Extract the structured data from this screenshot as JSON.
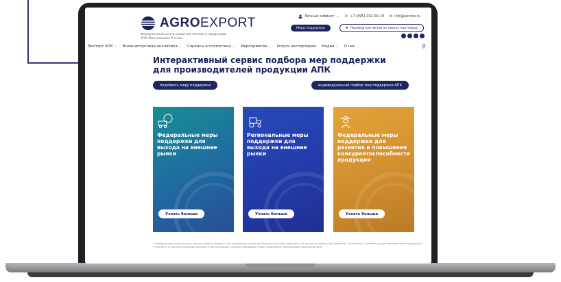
{
  "header": {
    "logo_bold": "AGRO",
    "logo_rest": "EXPORT",
    "logo_subtitle": "Федеральный центр развития экспорта продукции АПК Минсельхоза России",
    "cabinet_link": "Личный кабинет",
    "phone": "+7 (495) 232-00-19",
    "email": "info@aemcx.ru",
    "pill_dark": "Меры поддержки",
    "pill_outline": "Перевод контактов по поиску партнеров"
  },
  "nav": {
    "items": [
      "Экспорт АПК",
      "Внешнеторговая аналитика",
      "Сервисы и статистика",
      "Мероприятия",
      "Услуги экспортерам",
      "Медиа",
      "О нас"
    ]
  },
  "main": {
    "title": "Интерактивный сервис подбора мер поддержки для производителей продукции АПК",
    "btn_left": "подобрать меру поддержки",
    "btn_right": "индивидуальный подбор мер поддержки АПК",
    "cards": [
      {
        "text": "Федеральные меры поддержки для выхода на внешние рынки",
        "button": "Узнать больше"
      },
      {
        "text": "Региональные меры поддержки для выхода на внешние рынки",
        "button": "Узнать больше"
      },
      {
        "text": "Федеральные меры поддержки для развития и повышения конкурентоспособности продукции",
        "button": "Узнать больше"
      }
    ],
    "footnote": "* Информационный интерактивный сервис подбора мер поддержки носит рекомендательный характер и не является публичной офертой. Актуальные условия предоставления мер поддержки уточняйте в соответствующих органах и организациях, предоставляющих меры поддержки экспортерам продукции АПК."
  },
  "colors": {
    "brand_navy": "#1f2561",
    "card1": "#1a8d95",
    "card2": "#2749b8",
    "card3": "#e3a43a"
  }
}
